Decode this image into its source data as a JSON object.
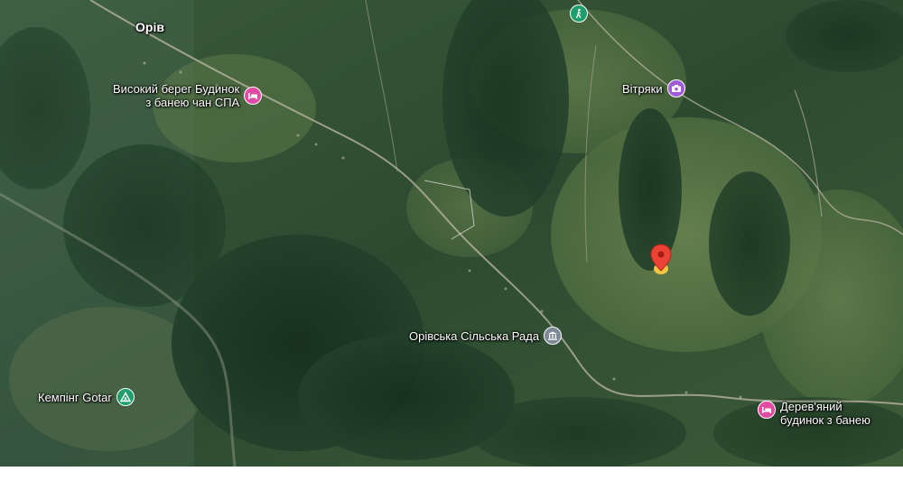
{
  "map": {
    "type": "satellite",
    "colors": {
      "forest_dark": "#1e3a24",
      "field_light": "#5b7a44",
      "road": "#bfb8a8",
      "hotel_pin": "#e24aa3",
      "landmark_pin": "#a15bd6",
      "gov_pin": "#7d8896",
      "camping_pin": "#1e9e6a",
      "park_pin": "#1e9e6a",
      "selected_marker": "#ea4335"
    }
  },
  "places": {
    "town": {
      "label": "Орів"
    },
    "hotel1": {
      "line1": "Високий берег Будинок",
      "line2": "з банею чан СПА",
      "icon": "hotel-icon"
    },
    "landmark": {
      "label": "Вітряки",
      "icon": "camera-icon"
    },
    "council": {
      "label": "Орівська Сільська Рада",
      "icon": "government-building-icon"
    },
    "camping": {
      "label": "Кемпінг Gotar",
      "icon": "camping-tent-icon"
    },
    "hotel2": {
      "line1": "Дерев'яний",
      "line2": "будинок з банею",
      "icon": "hotel-icon"
    },
    "park": {
      "icon": "hiking-icon"
    },
    "selected": {
      "icon": "selected-location-marker"
    }
  }
}
